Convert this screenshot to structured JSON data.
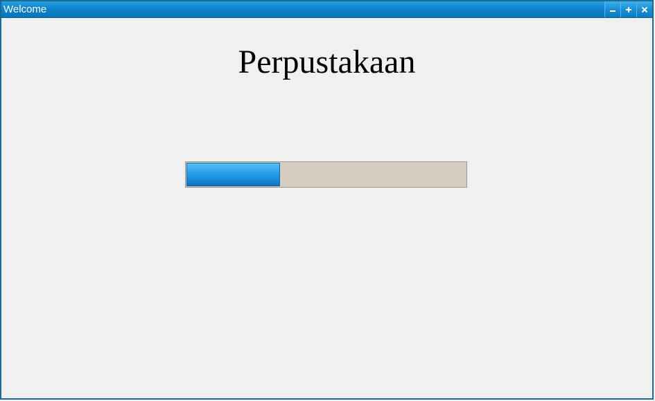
{
  "window": {
    "title": "Welcome"
  },
  "controls": {
    "minimize_icon": "minimize-icon",
    "maximize_icon": "maximize-icon",
    "close_icon": "close-icon"
  },
  "main": {
    "heading": "Perpustakaan",
    "progress_percent": 33.5
  },
  "colors": {
    "titlebar": "#0c84cf",
    "progress_fill": "#1689d8",
    "progress_track": "#d6cdc0",
    "background": "#f0f0f0"
  }
}
